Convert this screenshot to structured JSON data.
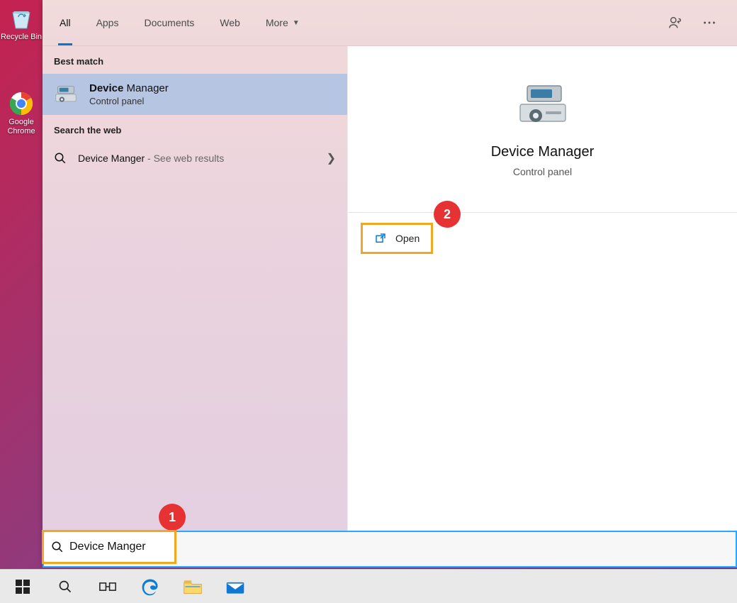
{
  "desktop": {
    "icons": [
      {
        "name": "recycle-bin-icon",
        "label": "Recycle Bin"
      },
      {
        "name": "chrome-icon",
        "label": "Google Chrome"
      }
    ]
  },
  "tabs": {
    "items": [
      "All",
      "Apps",
      "Documents",
      "Web",
      "More"
    ],
    "active_index": 0
  },
  "results": {
    "best_match_label": "Best match",
    "best_match": {
      "title_bold": "Device",
      "title_rest": " Manager",
      "subtitle": "Control panel"
    },
    "web_label": "Search the web",
    "web_item": {
      "query": "Device Manger",
      "suffix": " - See web results"
    }
  },
  "preview": {
    "title": "Device Manager",
    "subtitle": "Control panel",
    "open_label": "Open"
  },
  "search": {
    "value": "Device Manger"
  },
  "callouts": {
    "one": "1",
    "two": "2"
  }
}
